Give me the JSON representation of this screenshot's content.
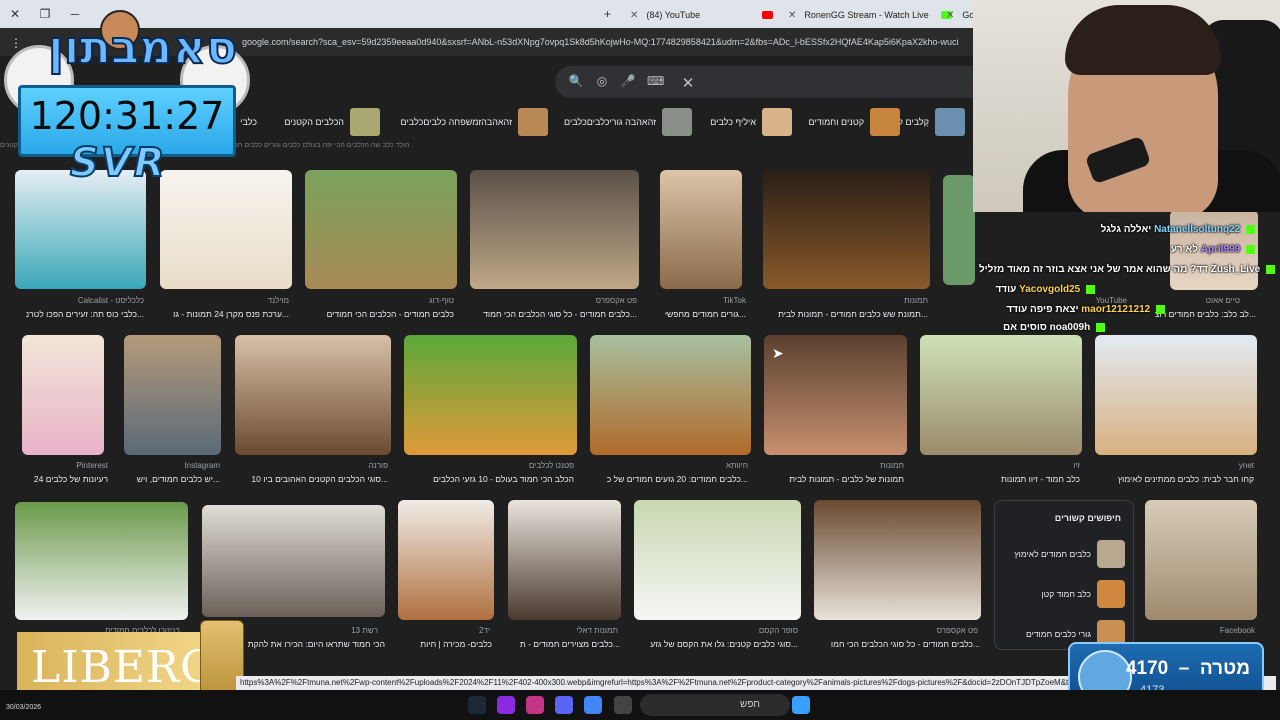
{
  "browser": {
    "tabs": [
      {
        "title": "(84) YouTube",
        "color": "#ff0000"
      },
      {
        "title": "RonenGG Stream - Watch Live",
        "color": "#53fc18"
      },
      {
        "title": "Go",
        "color": "#4285f4"
      }
    ],
    "url": "google.com/search?sca_esv=59d2359eeaa0d940&sxsrf=ANbL-n53dXNpg7ovpq1Sk8d5hKojwHo-MQ:1774829858421&udm=2&fbs=ADc_l-bESSfx2HQfAE4Kap5i6KpaX2kho-wuci"
  },
  "chips": [
    "קָלבים קטנים",
    "קטנים וחמודים",
    "איליף כלבים",
    "כלבים‎זהאהבה גוריכלבים",
    "כלבים‎זמשפחה כלבים‎זהאהבה",
    "הכלבים הקטנים",
    "כלבי"
  ],
  "chips_topline": "הולד כלב שה הכלבים הכי יפה בעולם        כלבים וגורים כלבים חמודים           כלבים הכי חמודים                        הכלבים הכי חמודים במדינה         כלבים חמודים                     כלבים קטנים",
  "results": [
    {
      "src": "Calcalist - כלכליסט",
      "cap": "כלבי כוס תה: זעירים הפכו לטרנ..."
    },
    {
      "src": "מוילנד",
      "cap": "ערכת פנס מקרן 24 תמונות - גו..."
    },
    {
      "src": "טוף-דוג",
      "cap": "כלבים חמודים - הכלבים הכי חמודים"
    },
    {
      "src": "פט אקספרס",
      "cap": "כלבים חמודים - כל סוגי הכלבים הכי חמוד..."
    },
    {
      "src": "TikTok",
      "cap": "גורים חמודים מחפשי..."
    },
    {
      "src": "תמונות",
      "cap": "תמונת שש כלבים חמודים - תמונות לבית..."
    },
    {
      "src": "YouTube",
      "cap": "לב כלב: כלבים חמודים רוצ..."
    },
    {
      "src": "טיים אאוט",
      "cap": "לב כלב: כלבים חמודים רוצ..."
    },
    {
      "src": "Pinterest",
      "cap": "24 רעיונות של כלבים"
    },
    {
      "src": "Instagram",
      "cap": "יש כלבים חמודים, ויש..."
    },
    {
      "src": "פורנה",
      "cap": "10 סוגי הכלבים הקטנים האהובים ביו..."
    },
    {
      "src": "פטנט לכלבים",
      "cap": "הכלב הכי חמוד בעולם - 10 גזעי הכלבים"
    },
    {
      "src": "חיוותא",
      "cap": "כלבים חמודים: 20 גזעים חמודים של כ..."
    },
    {
      "src": "תמונות",
      "cap": "תמונות של כלבים - תמונות לבית"
    },
    {
      "src": "זיו",
      "cap": "כלב חמוד - זיוו תמונות"
    },
    {
      "src": "ynet",
      "cap": "קחו חבר לבית: כלבים ממתינים לאימוץ"
    },
    {
      "src": "בנינוכו לכלבים חמודים",
      "cap": ""
    },
    {
      "src": "רשת 13",
      "cap": "הכי חמוד שתראו היום: הכירו את להקת"
    },
    {
      "src": "יד2",
      "cap": "כלבים- מכירה | חיות"
    },
    {
      "src": "תמונות דאלי",
      "cap": "כלבים מצוירים חמודים - ת..."
    },
    {
      "src": "סופר הקסם",
      "cap": "סוגי כלבים קטנים: גלו את הקסם של גזע..."
    },
    {
      "src": "פט אקספרס",
      "cap": "כלבים חמודים - כל סוגי הכלבים הכי חמו..."
    },
    {
      "src": "Facebook",
      "cap": ""
    }
  ],
  "related": {
    "title": "חיפושים קשורים",
    "items": [
      "כלבים חמודים לאימוץ",
      "כלב חמוד קטן",
      "גורי כלבים חמודים"
    ]
  },
  "overlay": {
    "brand": "סאמבתון",
    "timer": "120:31:27",
    "svr": "SVR",
    "ad": "LIBERO"
  },
  "chat": [
    {
      "user": "Natanellsoltunq22",
      "msg": "יאללה גלגל",
      "color": "#7fd6ff"
    },
    {
      "user": "April999",
      "msg": "לא רע",
      "color": "#b18cff"
    },
    {
      "user": "Zush_Live",
      "msg": "דד? מה שהוא אמר של אני אצא בוזר זה מאוד מזליל",
      "color": "#ffffff"
    },
    {
      "user": "Yacovgold25",
      "msg": "עודד",
      "color": "#ffd34d"
    },
    {
      "user": "maor12121212",
      "msg": "יצאת פיפה עודד",
      "color": "#ffd34d"
    },
    {
      "user": "noa009h",
      "msg": "סוסים אם",
      "color": "#ffffff"
    }
  ],
  "goal": {
    "label": "מטרה",
    "current": "4170",
    "sub": "4173"
  },
  "statusurl": "https%3A%2F%2Ftmuna.net%2Fwp-content%2Fuploads%2F2024%2F11%2F402-400x300.webp&imgrefurl=https%3A%2F%2Ftmuna.net%2Fproduct-category%2Fanimals-pictures%2Fdogs-pictures%2F&docid=2zDOnTJDTpZoeM&tbnid=...",
  "taskbar": {
    "search": "חפש",
    "date": "30/03/2026"
  }
}
